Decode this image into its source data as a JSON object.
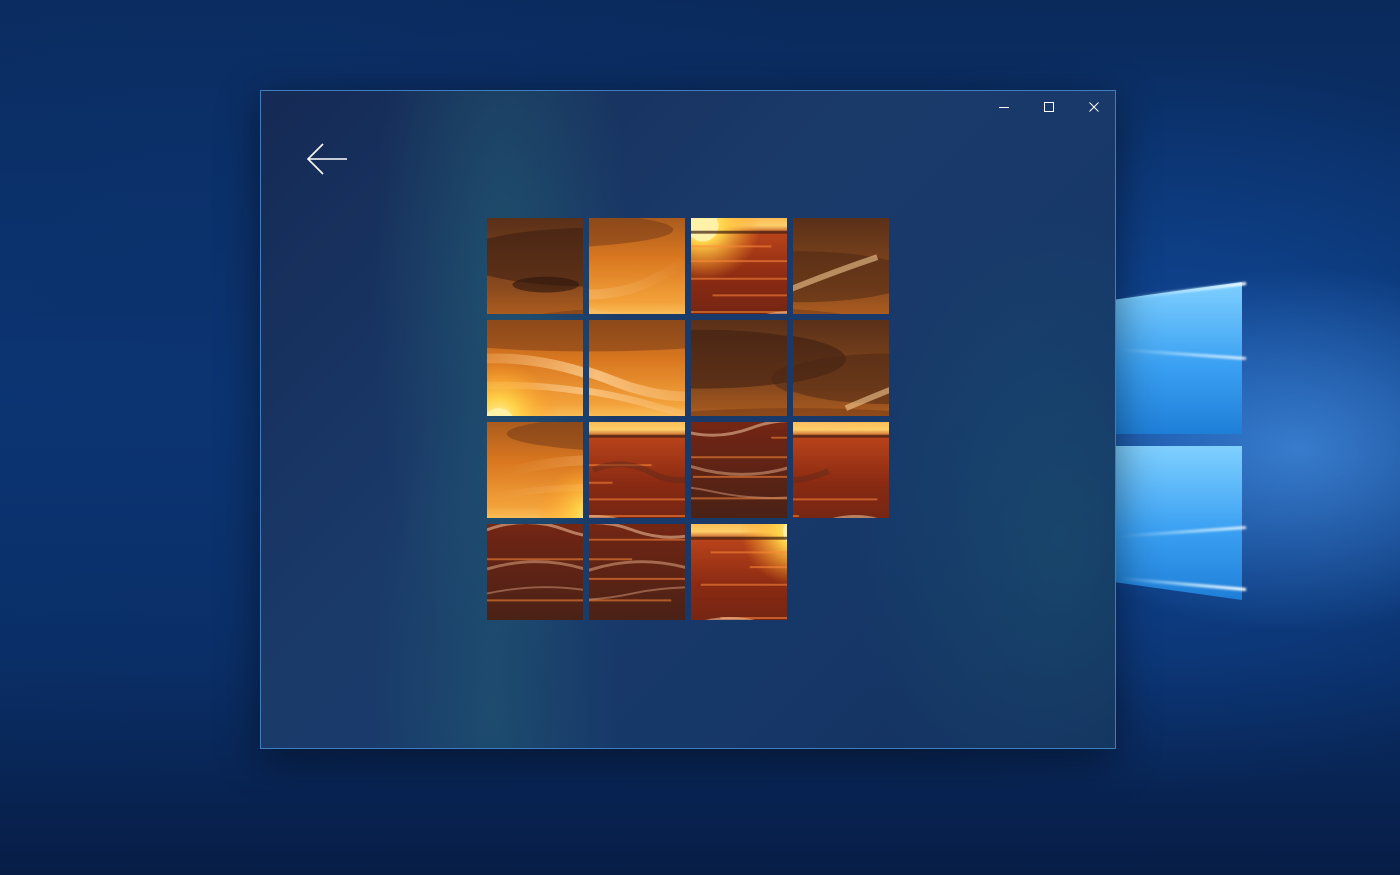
{
  "window": {
    "caption_buttons": {
      "minimize_icon": "minimize-icon",
      "maximize_icon": "maximize-icon",
      "close_icon": "close-icon"
    },
    "back_icon": "arrow-left-icon"
  },
  "puzzle": {
    "grid_size": 4,
    "empty_slot": {
      "row": 3,
      "col": 3
    },
    "tiles": [
      {
        "row": 0,
        "col": 0,
        "src_row": 0,
        "src_col": 0
      },
      {
        "row": 0,
        "col": 1,
        "src_row": 1,
        "src_col": 3
      },
      {
        "row": 0,
        "col": 2,
        "src_row": 2,
        "src_col": 1
      },
      {
        "row": 0,
        "col": 3,
        "src_row": 0,
        "src_col": 3
      },
      {
        "row": 1,
        "col": 0,
        "src_row": 1,
        "src_col": 1
      },
      {
        "row": 1,
        "col": 1,
        "src_row": 1,
        "src_col": 2
      },
      {
        "row": 1,
        "col": 2,
        "src_row": 0,
        "src_col": 1
      },
      {
        "row": 1,
        "col": 3,
        "src_row": 0,
        "src_col": 2
      },
      {
        "row": 2,
        "col": 0,
        "src_row": 1,
        "src_col": 0
      },
      {
        "row": 2,
        "col": 1,
        "src_row": 2,
        "src_col": 2
      },
      {
        "row": 2,
        "col": 2,
        "src_row": 3,
        "src_col": 1
      },
      {
        "row": 2,
        "col": 3,
        "src_row": 2,
        "src_col": 3
      },
      {
        "row": 3,
        "col": 0,
        "src_row": 3,
        "src_col": 0
      },
      {
        "row": 3,
        "col": 1,
        "src_row": 3,
        "src_col": 2
      },
      {
        "row": 3,
        "col": 2,
        "src_row": 2,
        "src_col": 0
      }
    ]
  },
  "colors": {
    "window_border": "#3f7dbf",
    "desktop_blue": "#0b3674",
    "sunset_orange": "#f08a24",
    "sunset_gold": "#ffc35a",
    "sea_red": "#9a2a10"
  }
}
